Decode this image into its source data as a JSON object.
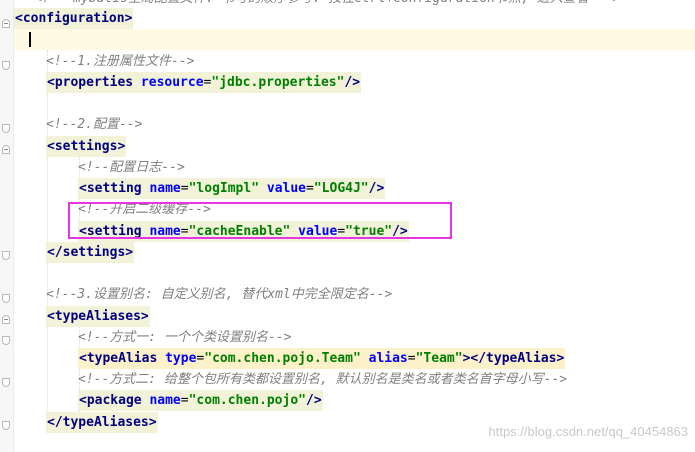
{
  "editor": {
    "lines": [
      {
        "segments": [
          {
            "t": "<!-- mybatis全局配置文件: 书写的顺序参考: 按住ctrl+configuration节点, 进入查看 -->",
            "c": "comment"
          }
        ]
      },
      {
        "segments": [
          {
            "t": "<",
            "c": "tag"
          },
          {
            "t": "configuration",
            "c": "tag"
          },
          {
            "t": ">",
            "c": "tag"
          }
        ]
      },
      {
        "segments": []
      },
      {
        "segments": []
      },
      {
        "segments": [
          {
            "t": "<!--1.注册属性文件-->",
            "c": "comment"
          }
        ]
      },
      {
        "segments": [
          {
            "t": "<",
            "c": "tag"
          },
          {
            "t": "properties ",
            "c": "tag"
          },
          {
            "t": "resource",
            "c": "attr"
          },
          {
            "t": "=",
            "c": "plain"
          },
          {
            "t": "\"jdbc.properties\"",
            "c": "val"
          },
          {
            "t": "/>",
            "c": "tag"
          }
        ]
      },
      {
        "segments": []
      },
      {
        "segments": [
          {
            "t": "<!--2.配置-->",
            "c": "comment"
          }
        ]
      },
      {
        "segments": [
          {
            "t": "<",
            "c": "tag"
          },
          {
            "t": "settings",
            "c": "tag"
          },
          {
            "t": ">",
            "c": "tag"
          }
        ]
      },
      {
        "segments": [
          {
            "t": "<!--配置日志-->",
            "c": "comment"
          }
        ]
      },
      {
        "segments": [
          {
            "t": "<",
            "c": "tag"
          },
          {
            "t": "setting ",
            "c": "tag"
          },
          {
            "t": "name",
            "c": "attr"
          },
          {
            "t": "=",
            "c": "plain"
          },
          {
            "t": "\"logImpl\"",
            "c": "val"
          },
          {
            "t": " ",
            "c": "plain"
          },
          {
            "t": "value",
            "c": "attr"
          },
          {
            "t": "=",
            "c": "plain"
          },
          {
            "t": "\"LOG4J\"",
            "c": "val"
          },
          {
            "t": "/>",
            "c": "tag"
          }
        ]
      },
      {
        "segments": [
          {
            "t": "<!--开启二级缓存-->",
            "c": "comment"
          }
        ]
      },
      {
        "segments": [
          {
            "t": "<",
            "c": "tag"
          },
          {
            "t": "setting ",
            "c": "tag"
          },
          {
            "t": "name",
            "c": "attr"
          },
          {
            "t": "=",
            "c": "plain"
          },
          {
            "t": "\"cacheEnable\"",
            "c": "val"
          },
          {
            "t": " ",
            "c": "plain"
          },
          {
            "t": "value",
            "c": "attr"
          },
          {
            "t": "=",
            "c": "plain"
          },
          {
            "t": "\"true\"",
            "c": "val"
          },
          {
            "t": "/>",
            "c": "tag"
          }
        ]
      },
      {
        "segments": [
          {
            "t": "</",
            "c": "tag"
          },
          {
            "t": "settings",
            "c": "tag"
          },
          {
            "t": ">",
            "c": "tag"
          }
        ]
      },
      {
        "segments": []
      },
      {
        "segments": [
          {
            "t": "<!--3.设置别名: 自定义别名, 替代xml中完全限定名-->",
            "c": "comment"
          }
        ]
      },
      {
        "segments": [
          {
            "t": "<",
            "c": "tag"
          },
          {
            "t": "typeAliases",
            "c": "tag"
          },
          {
            "t": ">",
            "c": "tag"
          }
        ]
      },
      {
        "segments": [
          {
            "t": "<!--方式一: 一个个类设置别名-->",
            "c": "comment"
          }
        ]
      },
      {
        "segments": [
          {
            "t": "<",
            "c": "tag"
          },
          {
            "t": "typeAlias ",
            "c": "tag"
          },
          {
            "t": "type",
            "c": "attr"
          },
          {
            "t": "=",
            "c": "plain"
          },
          {
            "t": "\"com.chen.pojo.Team\"",
            "c": "val"
          },
          {
            "t": " ",
            "c": "plain"
          },
          {
            "t": "alias",
            "c": "attr"
          },
          {
            "t": "=",
            "c": "plain"
          },
          {
            "t": "\"Team\"",
            "c": "val"
          },
          {
            "t": "></",
            "c": "tag"
          },
          {
            "t": "typeAlias",
            "c": "tag"
          },
          {
            "t": ">",
            "c": "tag"
          }
        ]
      },
      {
        "segments": [
          {
            "t": "<!--方式二: 给整个包所有类都设置别名, 默认别名是类名或者类名首字母小写-->",
            "c": "comment"
          }
        ]
      },
      {
        "segments": [
          {
            "t": "<",
            "c": "tag"
          },
          {
            "t": "package ",
            "c": "tag"
          },
          {
            "t": "name",
            "c": "attr"
          },
          {
            "t": "=",
            "c": "plain"
          },
          {
            "t": "\"com.chen.pojo\"",
            "c": "val"
          },
          {
            "t": "/>",
            "c": "tag"
          }
        ]
      },
      {
        "segments": [
          {
            "t": "</",
            "c": "tag"
          },
          {
            "t": "typeAliases",
            "c": "tag"
          },
          {
            "t": ">",
            "c": "tag"
          }
        ]
      }
    ]
  },
  "watermark": "https://blog.csdn.net/qq_40454863",
  "colors": {
    "comment": "#808080",
    "tag": "#000080",
    "attribute": "#0000ff",
    "value": "#008000",
    "annotation_box": "#e535e5",
    "caret_line": "#fffae3"
  }
}
